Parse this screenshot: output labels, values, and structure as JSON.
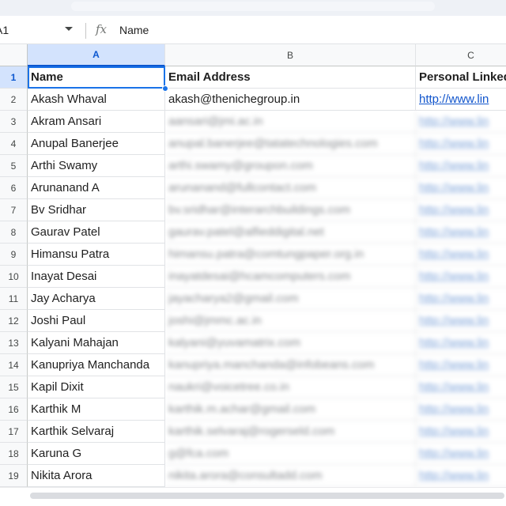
{
  "formula_bar": {
    "cell_ref": "A1",
    "fx_label": "fx",
    "value": "Name"
  },
  "columns": [
    "A",
    "B",
    "C"
  ],
  "row_numbers": [
    "1",
    "2",
    "3",
    "4",
    "5",
    "6",
    "7",
    "8",
    "9",
    "10",
    "11",
    "12",
    "13",
    "14",
    "15",
    "16",
    "17",
    "18",
    "19"
  ],
  "header_row": {
    "name": "Name",
    "email": "Email Address",
    "linkedin": "Personal Linked"
  },
  "rows": [
    {
      "name": "Akash Whaval",
      "email": "akash@thenichegroup.in",
      "linkedin": "http://www.lin"
    },
    {
      "name": "Akram Ansari",
      "email": "aansari@jmi.ac.in",
      "linkedin": "http://www.lin"
    },
    {
      "name": "Anupal Banerjee",
      "email": "anupal.banerjee@tatatechnologies.com",
      "linkedin": "http://www.lin"
    },
    {
      "name": "Arthi Swamy",
      "email": "arthi.swamy@groupon.com",
      "linkedin": "http://www.lin"
    },
    {
      "name": "Arunanand A",
      "email": "arunanand@fullcontact.com",
      "linkedin": "http://www.lin"
    },
    {
      "name": "Bv Sridhar",
      "email": "bv.sridhar@interarchbuildings.com",
      "linkedin": "http://www.lin"
    },
    {
      "name": "Gaurav Patel",
      "email": "gaurav.patel@alfieddigital.net",
      "linkedin": "http://www.lin"
    },
    {
      "name": "Himansu Patra",
      "email": "himansu.patra@comtungpaper.org.in",
      "linkedin": "http://www.lin"
    },
    {
      "name": "Inayat Desai",
      "email": "inayatdesai@hcamcomputers.com",
      "linkedin": "http://www.lin"
    },
    {
      "name": "Jay Acharya",
      "email": "jayacharya2@gmail.com",
      "linkedin": "http://www.lin"
    },
    {
      "name": "Joshi Paul",
      "email": "joshi@jmmc.ac.in",
      "linkedin": "http://www.lin"
    },
    {
      "name": "Kalyani Mahajan",
      "email": "kalyani@yuvamatrix.com",
      "linkedin": "http://www.lin"
    },
    {
      "name": "Kanupriya Manchanda",
      "email": "kanupriya.manchanda@infobeans.com",
      "linkedin": "http://www.lin"
    },
    {
      "name": "Kapil Dixit",
      "email": "naukri@voicetree.co.in",
      "linkedin": "http://www.lin"
    },
    {
      "name": "Karthik M",
      "email": "karthik.m.achar@gmail.com",
      "linkedin": "http://www.lin"
    },
    {
      "name": "Karthik Selvaraj",
      "email": "karthik.selvaraj@rogerseld.com",
      "linkedin": "http://www.lin"
    },
    {
      "name": "Karuna G",
      "email": "g@fca.com",
      "linkedin": "http://www.lin"
    },
    {
      "name": "Nikita Arora",
      "email": "nikita.arora@consultadd.com",
      "linkedin": "http://www.lin"
    }
  ]
}
